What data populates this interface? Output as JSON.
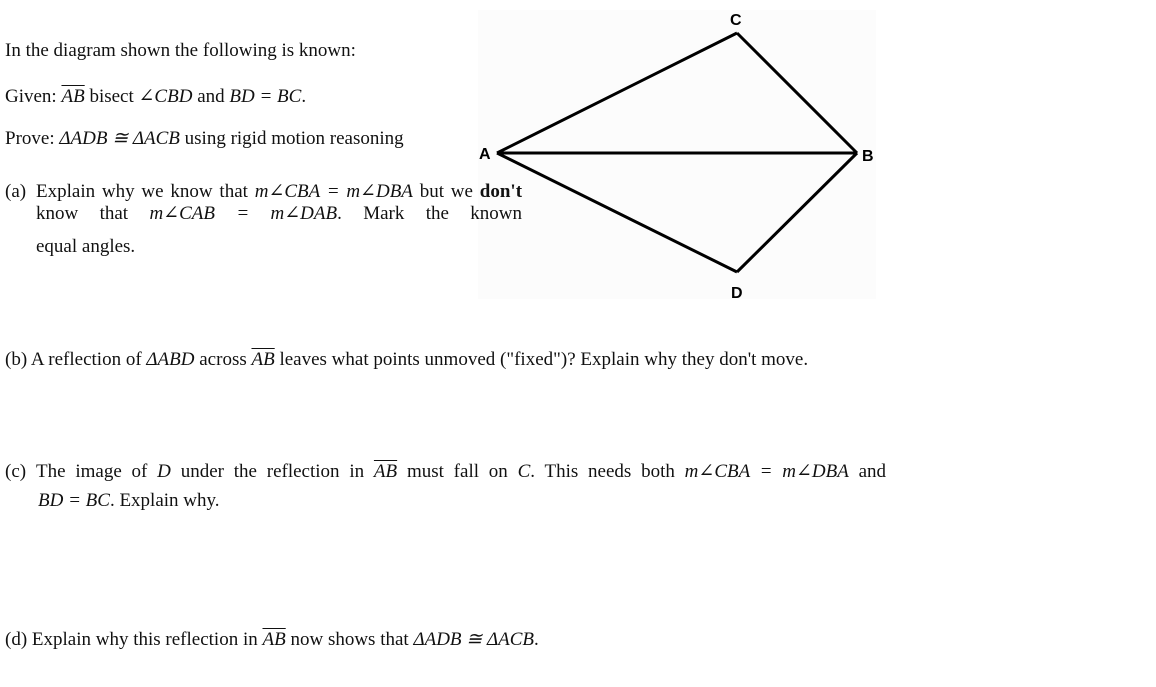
{
  "intro": {
    "line1": "In the diagram shown the following is known:",
    "given": {
      "label": "Given:",
      "segment": "AB",
      "verb": "bisect",
      "angle": "∠CBD",
      "conj": "and",
      "equation": "BD = BC",
      "end": "."
    },
    "prove": {
      "label": "Prove:",
      "statement": "ΔADB ≅ ΔACB",
      "rest": "using rigid motion reasoning"
    }
  },
  "part_a": {
    "marker": "(a)",
    "t1": "Explain why we know that",
    "eq1": "m∠CBA = m∠DBA",
    "t2": "but we",
    "bold": "don't",
    "t3": "know that",
    "eq2": "m∠CAB = m∠DAB",
    "t4": ". Mark the known",
    "t5": "equal angles."
  },
  "part_b": {
    "marker": "(b)",
    "t1": "A reflection of",
    "tri": "ΔABD",
    "t2": "across",
    "segment": "AB",
    "t3": "leaves what points unmoved (\"fixed\")? Explain why they don't move."
  },
  "part_c": {
    "marker": "(c)",
    "t1": "The image of",
    "point": "D",
    "t2": "under the reflection in",
    "segment": "AB",
    "t3": "must fall on",
    "point2": "C",
    "t4": ". This needs both",
    "eq1": "m∠CBA = m∠DBA",
    "t5": "and",
    "eq2": "BD = BC",
    "t6": ". Explain why."
  },
  "part_d": {
    "marker": "(d)",
    "t1": "Explain why this reflection in",
    "segment": "AB",
    "t2": "now shows that",
    "statement": "ΔADB ≅ ΔACB",
    "end": "."
  },
  "diagram": {
    "vertices": {
      "A": "A",
      "B": "B",
      "C": "C",
      "D": "D"
    },
    "segments": [
      "AC",
      "CB",
      "AB",
      "AD",
      "DB"
    ],
    "stroke_color": "#000000",
    "background_color": "#fcfcfc"
  }
}
